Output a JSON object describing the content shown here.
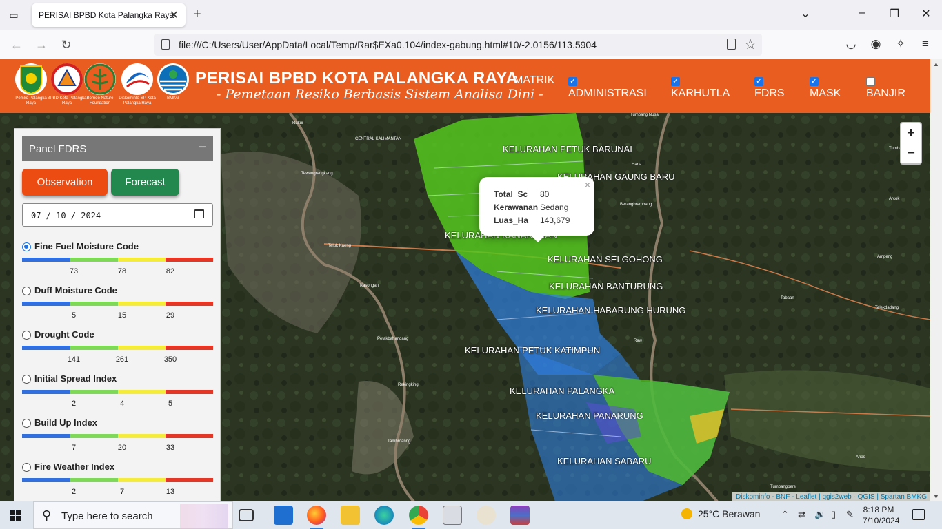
{
  "browser": {
    "tab_title": "PERISAI BPBD Kota Palangka Raya",
    "url": "file:///C:/Users/User/AppData/Local/Temp/Rar$EXa0.104/index-gabung.html#10/-2.0156/113.5904"
  },
  "header": {
    "logos": [
      {
        "caption": "Pemko Palangka Raya",
        "color": "#1e8a3a"
      },
      {
        "caption": "BPBD Kota Palangka Raya",
        "color": "#d62020"
      },
      {
        "caption": "Borneo Nature Foundation",
        "color": "#2e7d32"
      },
      {
        "caption": "Diskominfo-SP Kota Palangka Raya",
        "color": "#1565c0"
      },
      {
        "caption": "BMKG",
        "color": "#0d6fb8"
      }
    ],
    "title": "PERISAI BPBD KOTA PALANGKA RAYA",
    "subtitle": "- Pemetaan Resiko Berbasis Sistem Analisa Dini -",
    "matrik_label": "MATRIK",
    "layers": [
      {
        "label": "ADMINISTRASI",
        "checked": true
      },
      {
        "label": "KARHUTLA",
        "checked": true
      },
      {
        "label": "FDRS",
        "checked": true
      },
      {
        "label": "MASK",
        "checked": true
      },
      {
        "label": "BANJIR",
        "checked": false
      }
    ]
  },
  "panel": {
    "title": "Panel FDRS",
    "collapse_symbol": "−",
    "observation_label": "Observation",
    "forecast_label": "Forecast",
    "date_value": "07 / 10 / 2024",
    "scale_colors": [
      "#2f6fe0",
      "#7ed957",
      "#f5ec3a",
      "#e53525"
    ],
    "indices": [
      {
        "name": "Fine Fuel Moisture Code",
        "selected": true,
        "ticks": [
          "73",
          "78",
          "82"
        ]
      },
      {
        "name": "Duff Moisture Code",
        "selected": false,
        "ticks": [
          "5",
          "15",
          "29"
        ]
      },
      {
        "name": "Drought Code",
        "selected": false,
        "ticks": [
          "141",
          "261",
          "350"
        ]
      },
      {
        "name": "Initial Spread Index",
        "selected": false,
        "ticks": [
          "2",
          "4",
          "5"
        ]
      },
      {
        "name": "Build Up Index",
        "selected": false,
        "ticks": [
          "7",
          "20",
          "33"
        ]
      },
      {
        "name": "Fire Weather Index",
        "selected": false,
        "ticks": [
          "2",
          "7",
          "13"
        ]
      }
    ]
  },
  "map": {
    "kelurahan_labels": [
      "KELURAHAN PETUK BARUNAI",
      "KELURAHAN GAUNG BARU",
      "KELURAHAN KANARAKAN",
      "KELURAHAN SEI GOHONG",
      "KELURAHAN BANTURUNG",
      "KELURAHAN HABARUNG HURUNG",
      "KELURAHAN PETUK KATIMPUN",
      "KELURAHAN PALANGKA",
      "KELURAHAN PANARUNG",
      "KELURAHAN SABARU"
    ],
    "place_names": [
      "Tewangrangkang",
      "Teluk Kaeng",
      "Kasongan",
      "Petakbahandang",
      "Rekingking",
      "Tumbang Nusa",
      "Tambroanng",
      "CENTRAL KALIMANTAN",
      "Berangbrambang",
      "Ampeng",
      "Arcok",
      "Tabaan",
      "Telekdadang",
      "Tumbang",
      "Raw",
      "Ahas",
      "Tumbangpers",
      "Rakui",
      "Hana"
    ],
    "popup": {
      "close": "×",
      "rows": [
        {
          "key": "Total_Sc",
          "value": "80"
        },
        {
          "key": "Kerawanan",
          "value": "Sedang"
        },
        {
          "key": "Luas_Ha",
          "value": "143,679"
        }
      ]
    },
    "zoom_in": "+",
    "zoom_out": "−",
    "attribution": "Diskominfo - BNF - Leaflet | qgis2web · QGIS | Spartan BMKG"
  },
  "taskbar": {
    "search_placeholder": "Type here to search",
    "weather": "25°C  Berawan",
    "time": "8:18 PM",
    "date": "7/10/2024"
  }
}
